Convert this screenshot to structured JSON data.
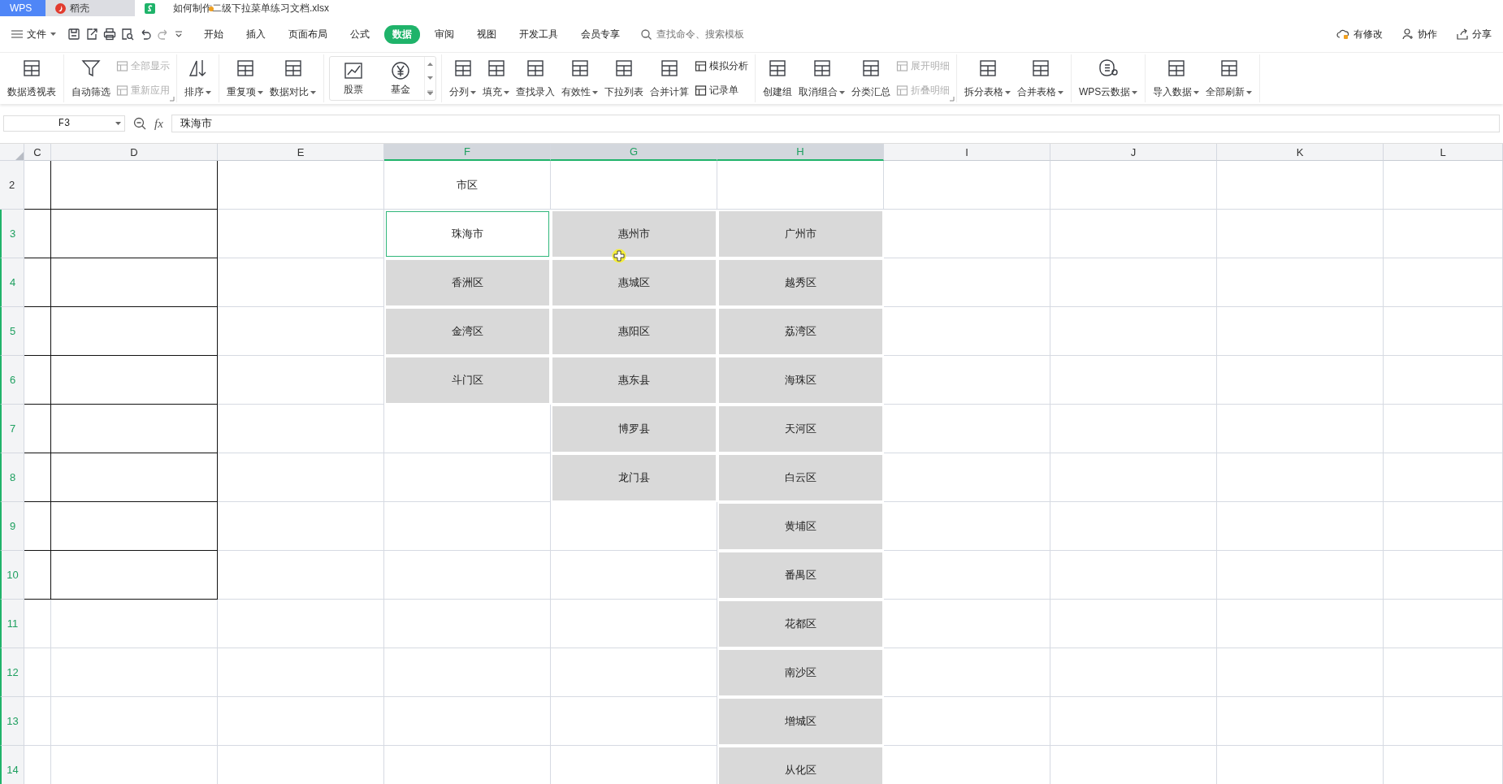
{
  "app_tabs": [
    {
      "kind": "brand",
      "label": "WPS",
      "selected": false,
      "modified": false
    },
    {
      "kind": "docer",
      "label": "稻壳",
      "selected": false,
      "modified": false
    },
    {
      "kind": "sheet",
      "label": "如何制作二级下拉菜单练习文档.xlsx",
      "selected": true,
      "modified": true
    }
  ],
  "menu": {
    "file_label": "文件",
    "tabs": [
      {
        "label": "开始",
        "selected": false
      },
      {
        "label": "插入",
        "selected": false
      },
      {
        "label": "页面布局",
        "selected": false
      },
      {
        "label": "公式",
        "selected": false
      },
      {
        "label": "数据",
        "selected": true
      },
      {
        "label": "审阅",
        "selected": false
      },
      {
        "label": "视图",
        "selected": false
      },
      {
        "label": "开发工具",
        "selected": false
      },
      {
        "label": "会员专享",
        "selected": false
      }
    ],
    "search": {
      "placeholder": "查找命令、搜索模板"
    },
    "actions": [
      "有修改",
      "协作",
      "分享"
    ]
  },
  "ribbon": {
    "groups": [
      {
        "launcher": false,
        "items": [
          {
            "kind": "large",
            "label": "数据透视表",
            "dropdown": false
          }
        ]
      },
      {
        "launcher": true,
        "items": [
          {
            "kind": "large",
            "label": "自动筛选",
            "dropdown": false
          },
          {
            "kind": "stack",
            "entries": [
              {
                "label": "全部显示",
                "disabled": true
              },
              {
                "label": "重新应用",
                "disabled": true
              }
            ]
          }
        ]
      },
      {
        "launcher": false,
        "items": [
          {
            "kind": "large",
            "label": "排序",
            "dropdown": true
          }
        ]
      },
      {
        "launcher": false,
        "items": [
          {
            "kind": "large",
            "label": "重复项",
            "dropdown": true
          },
          {
            "kind": "large",
            "label": "数据对比",
            "dropdown": true
          }
        ]
      },
      {
        "launcher": false,
        "items": [
          {
            "kind": "gallery",
            "entries": [
              "股票",
              "基金"
            ]
          }
        ]
      },
      {
        "launcher": false,
        "items": [
          {
            "kind": "large",
            "label": "分列",
            "dropdown": true
          },
          {
            "kind": "large",
            "label": "填充",
            "dropdown": true
          },
          {
            "kind": "large",
            "label": "查找录入",
            "dropdown": false
          },
          {
            "kind": "large",
            "label": "有效性",
            "dropdown": true
          },
          {
            "kind": "large",
            "label": "下拉列表",
            "dropdown": false
          },
          {
            "kind": "large",
            "label": "合并计算",
            "dropdown": false
          },
          {
            "kind": "stack",
            "entries": [
              {
                "label": "模拟分析",
                "disabled": false
              },
              {
                "label": "记录单",
                "disabled": false
              }
            ]
          }
        ]
      },
      {
        "launcher": true,
        "items": [
          {
            "kind": "large",
            "label": "创建组",
            "dropdown": false
          },
          {
            "kind": "large",
            "label": "取消组合",
            "dropdown": true
          },
          {
            "kind": "large",
            "label": "分类汇总",
            "dropdown": false
          },
          {
            "kind": "stack",
            "entries": [
              {
                "label": "展开明细",
                "disabled": true
              },
              {
                "label": "折叠明细",
                "disabled": true
              }
            ]
          }
        ]
      },
      {
        "launcher": false,
        "items": [
          {
            "kind": "large",
            "label": "拆分表格",
            "dropdown": true
          },
          {
            "kind": "large",
            "label": "合并表格",
            "dropdown": true
          }
        ]
      },
      {
        "launcher": false,
        "items": [
          {
            "kind": "large",
            "label": "WPS云数据",
            "dropdown": true
          }
        ]
      },
      {
        "launcher": false,
        "items": [
          {
            "kind": "large",
            "label": "导入数据",
            "dropdown": true
          },
          {
            "kind": "large",
            "label": "全部刷新",
            "dropdown": true
          }
        ]
      }
    ]
  },
  "formula_bar": {
    "cell_ref": "F3",
    "function_label": "fx",
    "value": "珠海市"
  },
  "sheet": {
    "columns": [
      {
        "label": "C",
        "selected": false
      },
      {
        "label": "D",
        "selected": false
      },
      {
        "label": "E",
        "selected": false
      },
      {
        "label": "F",
        "selected": true
      },
      {
        "label": "G",
        "selected": true
      },
      {
        "label": "H",
        "selected": true
      },
      {
        "label": "I",
        "selected": false
      },
      {
        "label": "J",
        "selected": false
      },
      {
        "label": "K",
        "selected": false
      },
      {
        "label": "L",
        "selected": false
      }
    ],
    "rows": [
      {
        "label": "2",
        "selected": false,
        "cells": [
          {
            "selected": false,
            "bordered": true,
            "active": false
          },
          {
            "selected": false,
            "bordered": true,
            "active": false
          },
          {
            "selected": false,
            "bordered": false,
            "active": false
          },
          {
            "text": "市区",
            "selected": false,
            "bordered": false,
            "active": false
          },
          {
            "selected": false,
            "bordered": false,
            "active": false
          },
          {
            "selected": false,
            "bordered": false,
            "active": false
          },
          {
            "selected": false,
            "bordered": false,
            "active": false
          },
          {
            "selected": false,
            "bordered": false,
            "active": false
          },
          {
            "selected": false,
            "bordered": false,
            "active": false
          },
          {
            "selected": false,
            "bordered": false,
            "active": false
          }
        ]
      },
      {
        "label": "3",
        "selected": true,
        "cells": [
          {
            "selected": false,
            "bordered": true,
            "active": false
          },
          {
            "selected": false,
            "bordered": true,
            "active": false
          },
          {
            "selected": false,
            "bordered": false,
            "active": false
          },
          {
            "text": "珠海市",
            "selected": false,
            "bordered": false,
            "active": true
          },
          {
            "text": "惠州市",
            "selected": true,
            "bordered": false,
            "active": false
          },
          {
            "text": "广州市",
            "selected": true,
            "bordered": false,
            "active": false
          },
          {
            "selected": false,
            "bordered": false,
            "active": false
          },
          {
            "selected": false,
            "bordered": false,
            "active": false
          },
          {
            "selected": false,
            "bordered": false,
            "active": false
          },
          {
            "selected": false,
            "bordered": false,
            "active": false
          }
        ]
      },
      {
        "label": "4",
        "selected": true,
        "cells": [
          {
            "selected": false,
            "bordered": true,
            "active": false
          },
          {
            "selected": false,
            "bordered": true,
            "active": false
          },
          {
            "selected": false,
            "bordered": false,
            "active": false
          },
          {
            "text": "香洲区",
            "selected": true,
            "bordered": false,
            "active": false
          },
          {
            "text": "惠城区",
            "selected": true,
            "bordered": false,
            "active": false
          },
          {
            "text": "越秀区",
            "selected": true,
            "bordered": false,
            "active": false
          },
          {
            "selected": false,
            "bordered": false,
            "active": false
          },
          {
            "selected": false,
            "bordered": false,
            "active": false
          },
          {
            "selected": false,
            "bordered": false,
            "active": false
          },
          {
            "selected": false,
            "bordered": false,
            "active": false
          }
        ]
      },
      {
        "label": "5",
        "selected": true,
        "cells": [
          {
            "selected": false,
            "bordered": true,
            "active": false
          },
          {
            "selected": false,
            "bordered": true,
            "active": false
          },
          {
            "selected": false,
            "bordered": false,
            "active": false
          },
          {
            "text": "金湾区",
            "selected": true,
            "bordered": false,
            "active": false
          },
          {
            "text": "惠阳区",
            "selected": true,
            "bordered": false,
            "active": false
          },
          {
            "text": "荔湾区",
            "selected": true,
            "bordered": false,
            "active": false
          },
          {
            "selected": false,
            "bordered": false,
            "active": false
          },
          {
            "selected": false,
            "bordered": false,
            "active": false
          },
          {
            "selected": false,
            "bordered": false,
            "active": false
          },
          {
            "selected": false,
            "bordered": false,
            "active": false
          }
        ]
      },
      {
        "label": "6",
        "selected": true,
        "cells": [
          {
            "selected": false,
            "bordered": true,
            "active": false
          },
          {
            "selected": false,
            "bordered": true,
            "active": false
          },
          {
            "selected": false,
            "bordered": false,
            "active": false
          },
          {
            "text": "斗门区",
            "selected": true,
            "bordered": false,
            "active": false
          },
          {
            "text": "惠东县",
            "selected": true,
            "bordered": false,
            "active": false
          },
          {
            "text": "海珠区",
            "selected": true,
            "bordered": false,
            "active": false
          },
          {
            "selected": false,
            "bordered": false,
            "active": false
          },
          {
            "selected": false,
            "bordered": false,
            "active": false
          },
          {
            "selected": false,
            "bordered": false,
            "active": false
          },
          {
            "selected": false,
            "bordered": false,
            "active": false
          }
        ]
      },
      {
        "label": "7",
        "selected": true,
        "cells": [
          {
            "selected": false,
            "bordered": true,
            "active": false
          },
          {
            "selected": false,
            "bordered": true,
            "active": false
          },
          {
            "selected": false,
            "bordered": false,
            "active": false
          },
          {
            "selected": false,
            "bordered": false,
            "active": false
          },
          {
            "text": "博罗县",
            "selected": true,
            "bordered": false,
            "active": false
          },
          {
            "text": "天河区",
            "selected": true,
            "bordered": false,
            "active": false
          },
          {
            "selected": false,
            "bordered": false,
            "active": false
          },
          {
            "selected": false,
            "bordered": false,
            "active": false
          },
          {
            "selected": false,
            "bordered": false,
            "active": false
          },
          {
            "selected": false,
            "bordered": false,
            "active": false
          }
        ]
      },
      {
        "label": "8",
        "selected": true,
        "cells": [
          {
            "selected": false,
            "bordered": true,
            "active": false
          },
          {
            "selected": false,
            "bordered": true,
            "active": false
          },
          {
            "selected": false,
            "bordered": false,
            "active": false
          },
          {
            "selected": false,
            "bordered": false,
            "active": false
          },
          {
            "text": "龙门县",
            "selected": true,
            "bordered": false,
            "active": false
          },
          {
            "text": "白云区",
            "selected": true,
            "bordered": false,
            "active": false
          },
          {
            "selected": false,
            "bordered": false,
            "active": false
          },
          {
            "selected": false,
            "bordered": false,
            "active": false
          },
          {
            "selected": false,
            "bordered": false,
            "active": false
          },
          {
            "selected": false,
            "bordered": false,
            "active": false
          }
        ]
      },
      {
        "label": "9",
        "selected": true,
        "cells": [
          {
            "selected": false,
            "bordered": true,
            "active": false
          },
          {
            "selected": false,
            "bordered": true,
            "active": false
          },
          {
            "selected": false,
            "bordered": false,
            "active": false
          },
          {
            "selected": false,
            "bordered": false,
            "active": false
          },
          {
            "selected": false,
            "bordered": false,
            "active": false
          },
          {
            "text": "黄埔区",
            "selected": true,
            "bordered": false,
            "active": false
          },
          {
            "selected": false,
            "bordered": false,
            "active": false
          },
          {
            "selected": false,
            "bordered": false,
            "active": false
          },
          {
            "selected": false,
            "bordered": false,
            "active": false
          },
          {
            "selected": false,
            "bordered": false,
            "active": false
          }
        ]
      },
      {
        "label": "10",
        "selected": true,
        "cells": [
          {
            "selected": false,
            "bordered": true,
            "active": false
          },
          {
            "selected": false,
            "bordered": true,
            "active": false
          },
          {
            "selected": false,
            "bordered": false,
            "active": false
          },
          {
            "selected": false,
            "bordered": false,
            "active": false
          },
          {
            "selected": false,
            "bordered": false,
            "active": false
          },
          {
            "text": "番禺区",
            "selected": true,
            "bordered": false,
            "active": false
          },
          {
            "selected": false,
            "bordered": false,
            "active": false
          },
          {
            "selected": false,
            "bordered": false,
            "active": false
          },
          {
            "selected": false,
            "bordered": false,
            "active": false
          },
          {
            "selected": false,
            "bordered": false,
            "active": false
          }
        ]
      },
      {
        "label": "11",
        "selected": true,
        "cells": [
          {
            "selected": false,
            "bordered": false,
            "active": false
          },
          {
            "selected": false,
            "bordered": false,
            "active": false
          },
          {
            "selected": false,
            "bordered": false,
            "active": false
          },
          {
            "selected": false,
            "bordered": false,
            "active": false
          },
          {
            "selected": false,
            "bordered": false,
            "active": false
          },
          {
            "text": "花都区",
            "selected": true,
            "bordered": false,
            "active": false
          },
          {
            "selected": false,
            "bordered": false,
            "active": false
          },
          {
            "selected": false,
            "bordered": false,
            "active": false
          },
          {
            "selected": false,
            "bordered": false,
            "active": false
          },
          {
            "selected": false,
            "bordered": false,
            "active": false
          }
        ]
      },
      {
        "label": "12",
        "selected": true,
        "cells": [
          {
            "selected": false,
            "bordered": false,
            "active": false
          },
          {
            "selected": false,
            "bordered": false,
            "active": false
          },
          {
            "selected": false,
            "bordered": false,
            "active": false
          },
          {
            "selected": false,
            "bordered": false,
            "active": false
          },
          {
            "selected": false,
            "bordered": false,
            "active": false
          },
          {
            "text": "南沙区",
            "selected": true,
            "bordered": false,
            "active": false
          },
          {
            "selected": false,
            "bordered": false,
            "active": false
          },
          {
            "selected": false,
            "bordered": false,
            "active": false
          },
          {
            "selected": false,
            "bordered": false,
            "active": false
          },
          {
            "selected": false,
            "bordered": false,
            "active": false
          }
        ]
      },
      {
        "label": "13",
        "selected": true,
        "cells": [
          {
            "selected": false,
            "bordered": false,
            "active": false
          },
          {
            "selected": false,
            "bordered": false,
            "active": false
          },
          {
            "selected": false,
            "bordered": false,
            "active": false
          },
          {
            "selected": false,
            "bordered": false,
            "active": false
          },
          {
            "selected": false,
            "bordered": false,
            "active": false
          },
          {
            "text": "增城区",
            "selected": true,
            "bordered": false,
            "active": false
          },
          {
            "selected": false,
            "bordered": false,
            "active": false
          },
          {
            "selected": false,
            "bordered": false,
            "active": false
          },
          {
            "selected": false,
            "bordered": false,
            "active": false
          },
          {
            "selected": false,
            "bordered": false,
            "active": false
          }
        ]
      },
      {
        "label": "14",
        "selected": true,
        "cells": [
          {
            "selected": false,
            "bordered": false,
            "active": false
          },
          {
            "selected": false,
            "bordered": false,
            "active": false
          },
          {
            "selected": false,
            "bordered": false,
            "active": false
          },
          {
            "selected": false,
            "bordered": false,
            "active": false
          },
          {
            "selected": false,
            "bordered": false,
            "active": false
          },
          {
            "text": "从化区",
            "selected": true,
            "bordered": false,
            "active": false
          },
          {
            "selected": false,
            "bordered": false,
            "active": false
          },
          {
            "selected": false,
            "bordered": false,
            "active": false
          },
          {
            "selected": false,
            "bordered": false,
            "active": false
          },
          {
            "selected": false,
            "bordered": false,
            "active": false
          }
        ]
      }
    ]
  }
}
